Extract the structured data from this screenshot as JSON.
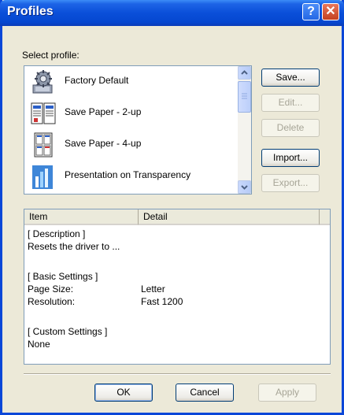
{
  "window": {
    "title": "Profiles"
  },
  "titlebar": {
    "help_glyph": "?",
    "close_glyph": "✕"
  },
  "select_label": "Select profile:",
  "profiles": [
    {
      "label": "Factory Default",
      "icon": "factory-default-icon"
    },
    {
      "label": "Save Paper - 2-up",
      "icon": "two-up-icon"
    },
    {
      "label": "Save Paper - 4-up",
      "icon": "four-up-icon"
    },
    {
      "label": "Presentation on Transparency",
      "icon": "transparency-icon"
    }
  ],
  "buttons": {
    "save": "Save...",
    "edit": "Edit...",
    "delete": "Delete",
    "import": "Import...",
    "export": "Export...",
    "ok": "OK",
    "cancel": "Cancel",
    "apply": "Apply"
  },
  "details": {
    "col_item": "Item",
    "col_detail": "Detail",
    "description_header": "[ Description ]",
    "description_text": "Resets the driver to ...",
    "basic_header": "[ Basic Settings ]",
    "page_size_label": "Page Size:",
    "page_size_value": "Letter",
    "resolution_label": "Resolution:",
    "resolution_value": "Fast 1200",
    "custom_header": "[ Custom Settings ]",
    "custom_value": "None"
  },
  "colors": {
    "titlebar": "#0a4fd9",
    "close": "#c3401f",
    "face": "#ece9d8"
  }
}
